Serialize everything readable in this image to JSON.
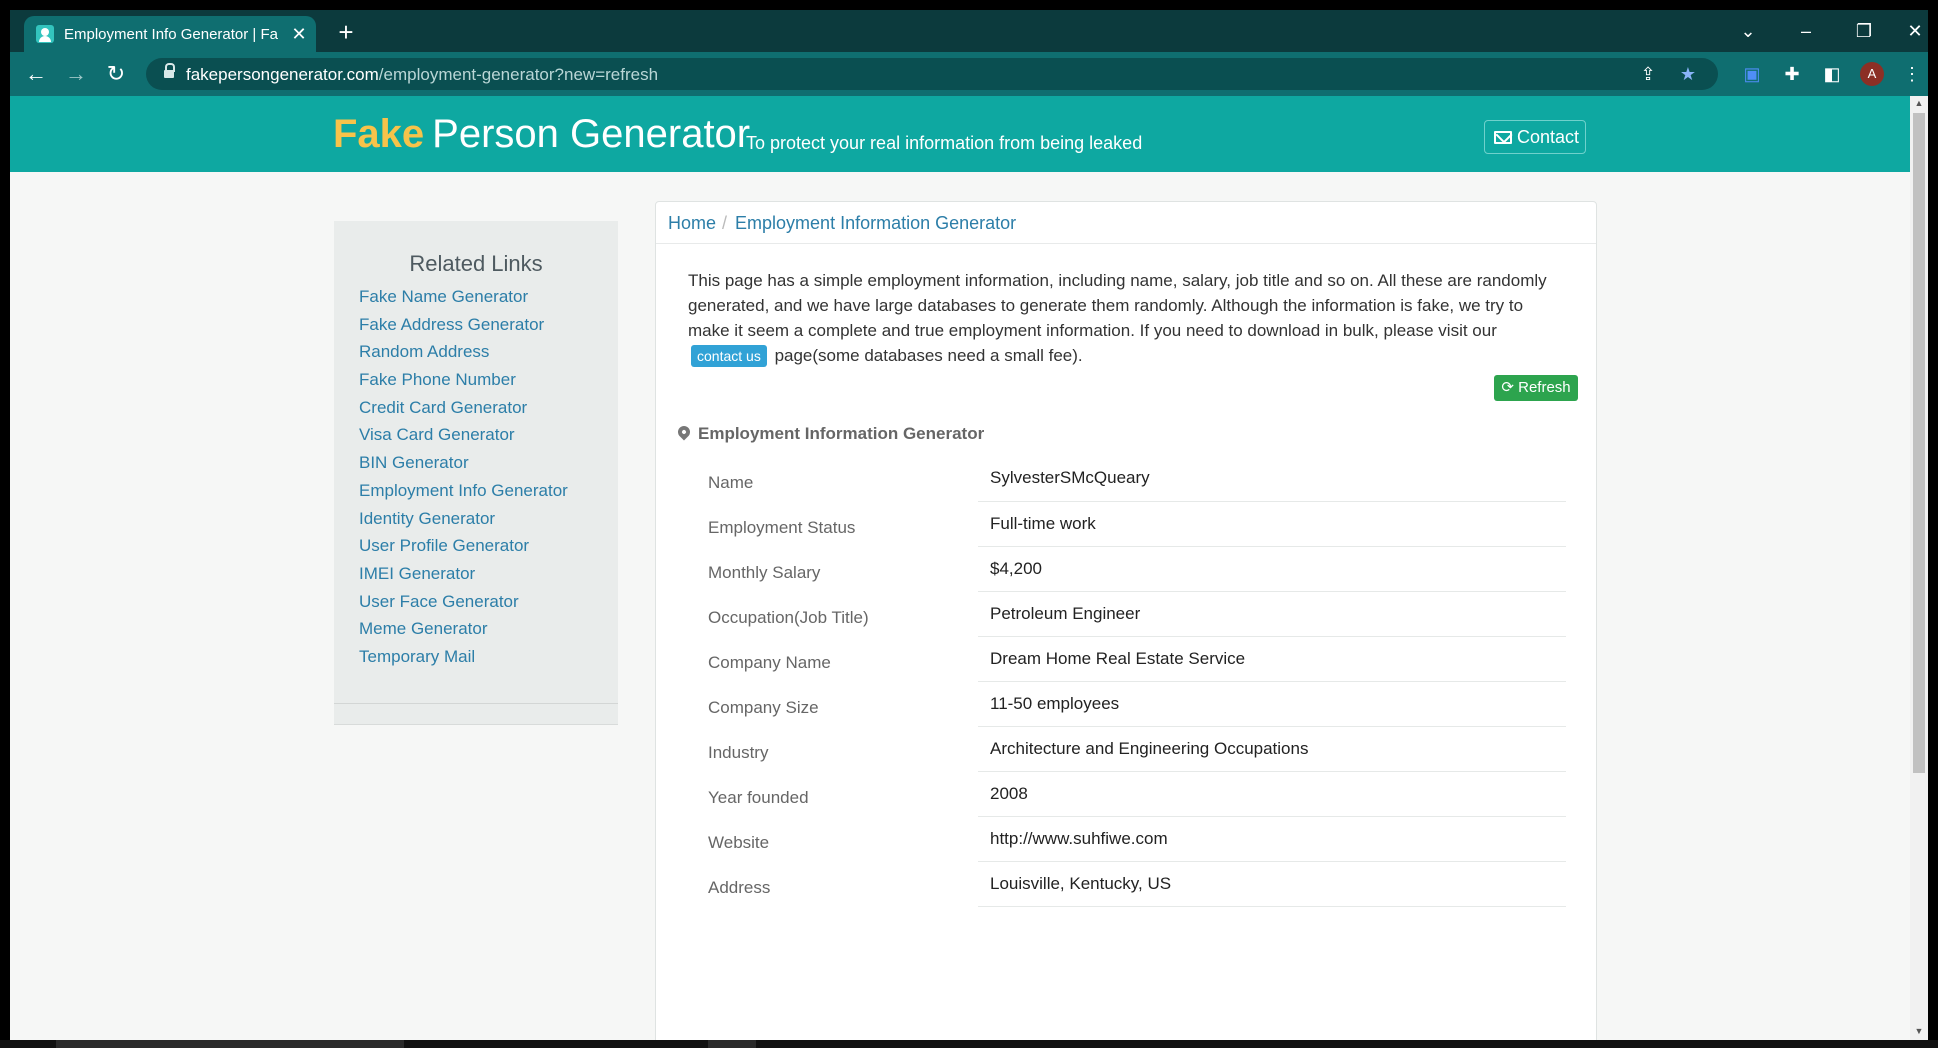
{
  "browser": {
    "tab_title": "Employment Info Generator | Fak",
    "close_tab": "✕",
    "new_tab": "+",
    "url_domain": "fakepersongenerator.com",
    "url_path": "/employment-generator?new=refresh",
    "profile_initial": "A"
  },
  "header": {
    "brand_fake": "Fake",
    "brand_rest": "Person Generator",
    "tagline": "To protect your real information from being leaked",
    "contact_label": "Contact",
    "accent_color": "#0ea8a1"
  },
  "sidebar": {
    "title": "Related Links",
    "links": [
      "Fake Name Generator",
      "Fake Address Generator",
      "Random Address",
      "Fake Phone Number",
      "Credit Card Generator",
      "Visa Card Generator",
      "BIN Generator",
      "Employment Info Generator",
      "Identity Generator",
      "User Profile Generator",
      "IMEI Generator",
      "User Face Generator",
      "Meme Generator",
      "Temporary Mail"
    ]
  },
  "breadcrumb": {
    "home": "Home",
    "separator": "/",
    "current": "Employment Information Generator"
  },
  "intro": {
    "text_before": "This page has a simple employment information, including name, salary, job title and so on. All these are randomly generated, and we have large databases to generate them randomly. Although the information is fake, we try to make it seem a complete and true employment information. If you need to download in bulk, please visit our",
    "link_label": "contact us",
    "text_after": "page(some databases need a small fee)."
  },
  "refresh_label": "Refresh",
  "section_title": "Employment Information Generator",
  "employment": [
    {
      "label": "Name",
      "value": "SylvesterSMcQueary"
    },
    {
      "label": "Employment Status",
      "value": "Full-time work"
    },
    {
      "label": "Monthly Salary",
      "value": "$4,200"
    },
    {
      "label": "Occupation(Job Title)",
      "value": "Petroleum Engineer"
    },
    {
      "label": "Company Name",
      "value": "Dream Home Real Estate Service"
    },
    {
      "label": "Company Size",
      "value": "11-50 employees"
    },
    {
      "label": "Industry",
      "value": "Architecture and Engineering Occupations"
    },
    {
      "label": "Year founded",
      "value": "2008"
    },
    {
      "label": "Website",
      "value": "http://www.suhfiwe.com"
    },
    {
      "label": "Address",
      "value": "Louisville, Kentucky, US"
    }
  ]
}
